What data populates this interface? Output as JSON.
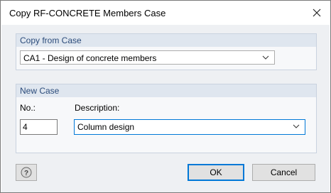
{
  "window": {
    "title": "Copy RF-CONCRETE Members Case"
  },
  "copy_from": {
    "header": "Copy from Case",
    "selected": "CA1 - Design of concrete members"
  },
  "new_case": {
    "header": "New Case",
    "no_label": "No.:",
    "no_value": "4",
    "description_label": "Description:",
    "description_value": "Column design"
  },
  "buttons": {
    "ok": "OK",
    "cancel": "Cancel"
  },
  "icons": {
    "close": "close-icon",
    "help": "help-icon",
    "dropdown": "chevron-down-icon"
  }
}
